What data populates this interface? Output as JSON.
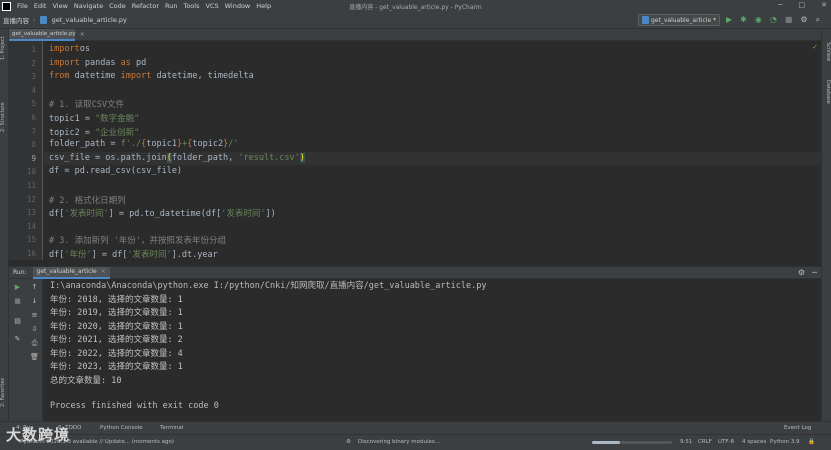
{
  "menubar": {
    "items": [
      "File",
      "Edit",
      "View",
      "Navigate",
      "Code",
      "Refactor",
      "Run",
      "Tools",
      "VCS",
      "Window",
      "Help"
    ],
    "window_title": "直播内容 - get_valuable_article.py - PyCharm"
  },
  "navbar": {
    "project": "直播内容",
    "file": "get_valuable_article.py",
    "run_config": "get_valuable_article"
  },
  "left_tools": [
    "1: Project",
    "2: Structure",
    "2: Favorites"
  ],
  "right_tools": [
    "SciView",
    "Database"
  ],
  "editor": {
    "tab_label": "get_valuable_article.py",
    "current_line": 9,
    "line_numbers": [
      "1",
      "2",
      "3",
      "4",
      "5",
      "6",
      "7",
      "8",
      "9",
      "10",
      "11",
      "12",
      "13",
      "14",
      "15",
      "16"
    ],
    "code_lines": [
      [
        [
          "kw",
          "import"
        ],
        [
          "",
          "os"
        ]
      ],
      [
        [
          "kw",
          "import"
        ],
        [
          "",
          " pandas "
        ],
        [
          "kw",
          "as"
        ],
        [
          "",
          " pd"
        ]
      ],
      [
        [
          "kw",
          "from"
        ],
        [
          "",
          " datetime "
        ],
        [
          "kw",
          "import"
        ],
        [
          "",
          " datetime, timedelta"
        ]
      ],
      [],
      [
        [
          "cmt",
          "# 1. 读取CSV文件"
        ]
      ],
      [
        [
          "",
          "topic1 = "
        ],
        [
          "str",
          "\"数字金融\""
        ]
      ],
      [
        [
          "",
          "topic2 = "
        ],
        [
          "str",
          "\"企业创新\""
        ]
      ],
      [
        [
          "",
          "folder_path = "
        ],
        [
          "str",
          "f'./"
        ],
        [
          "brace",
          "{"
        ],
        [
          "",
          "topic1"
        ],
        [
          "brace",
          "}"
        ],
        [
          "str",
          "+"
        ],
        [
          "brace",
          "{"
        ],
        [
          "",
          "topic2"
        ],
        [
          "brace",
          "}"
        ],
        [
          "str",
          "/'"
        ]
      ],
      [
        [
          "",
          "csv_file = os.path.join"
        ],
        [
          "hl",
          "("
        ],
        [
          "",
          "folder_path, "
        ],
        [
          "str",
          "'result.csv'"
        ],
        [
          "hl",
          ")"
        ]
      ],
      [
        [
          "",
          "df = pd.read_csv(csv_file)"
        ]
      ],
      [],
      [
        [
          "cmt",
          "# 2. 格式化日期列"
        ]
      ],
      [
        [
          "",
          "df["
        ],
        [
          "str",
          "'发表时间'"
        ],
        [
          "",
          "] = pd.to_datetime(df["
        ],
        [
          "str",
          "'发表时间'"
        ],
        [
          "",
          "])"
        ]
      ],
      [],
      [
        [
          "cmt",
          "# 3. 添加新列 '年份'，并按照发表年份分组"
        ]
      ],
      [
        [
          "",
          "df["
        ],
        [
          "str",
          "'年份'"
        ],
        [
          "",
          "] = df["
        ],
        [
          "str",
          "'发表时间'"
        ],
        [
          "",
          "].dt.year"
        ]
      ]
    ]
  },
  "run_panel": {
    "label": "Run:",
    "tab_label": "get_valuable_article",
    "console_lines": [
      "I:\\anaconda\\Anaconda\\python.exe I:/python/Cnki/知网爬取/直播内容/get_valuable_article.py",
      "年份: 2018, 选择的文章数量: 1",
      "年份: 2019, 选择的文章数量: 1",
      "年份: 2020, 选择的文章数量: 1",
      "年份: 2021, 选择的文章数量: 2",
      "年份: 2022, 选择的文章数量: 4",
      "年份: 2023, 选择的文章数量: 1",
      "总的文章数量: 10",
      "",
      "Process finished with exit code 0"
    ]
  },
  "bottom_tabs": [
    "4: Run",
    "6: TODO",
    "Python Console",
    "Terminal"
  ],
  "event_log": "Event Log",
  "status": {
    "left": "PyCharm 2020.3.3 available // Update... (moments ago)",
    "task": "Discovering binary modules...",
    "progress_fraction": 0.35,
    "position": "9:51",
    "line_sep": "CRLF",
    "encoding": "UTF-8",
    "indent": "4 spaces",
    "interpreter": "Python 3.9"
  },
  "watermark": "大数跨境"
}
